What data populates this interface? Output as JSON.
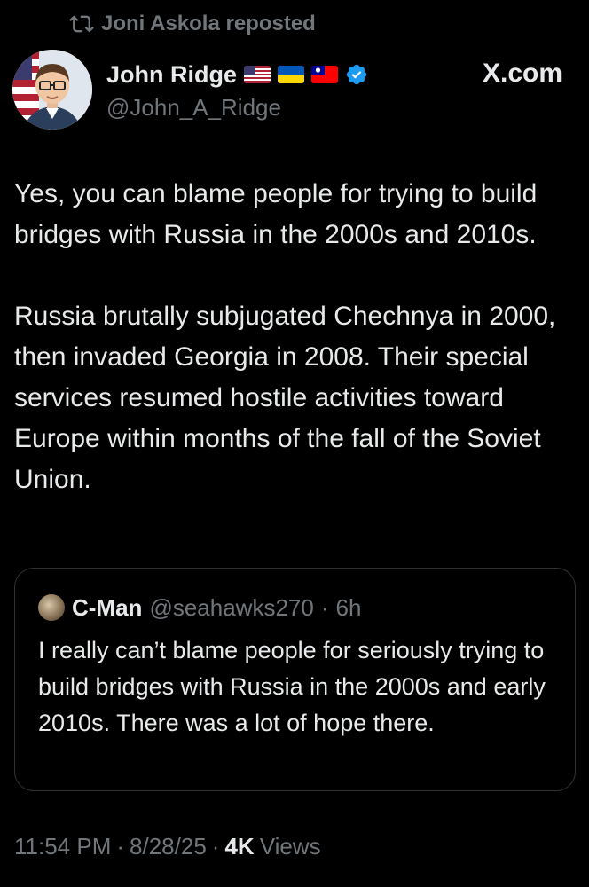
{
  "repost": {
    "icon": "repost-icon",
    "text": "Joni Askola reposted"
  },
  "author": {
    "name": "John Ridge",
    "handle": "@John_A_Ridge",
    "flags": [
      "us-flag-icon",
      "ukraine-flag-icon",
      "taiwan-flag-icon"
    ],
    "verified": true,
    "verified_color": "#1d9bf0"
  },
  "brand": "X.com",
  "post": {
    "paragraphs": [
      "Yes, you can blame people for trying to build bridges with Russia in the 2000s and 2010s.",
      "Russia brutally subjugated Chechnya in 2000, then invaded Georgia in 2008. Their special services resumed hostile activities toward Europe within months of the fall of the Soviet Union."
    ]
  },
  "quote": {
    "name": "C-Man",
    "handle": "@seahawks270",
    "time": "6h",
    "separator": "·",
    "text": "I really can’t blame people for seriously trying to build bridges with Russia in the 2000s and early 2010s. There was a lot of hope there."
  },
  "meta": {
    "time": "11:54 PM",
    "date": "8/28/25",
    "separator": "·",
    "views_count": "4K",
    "views_label": "Views"
  },
  "colors": {
    "background": "#000000",
    "text": "#e7e9ea",
    "secondary": "#71767b",
    "border": "#2f3336"
  }
}
